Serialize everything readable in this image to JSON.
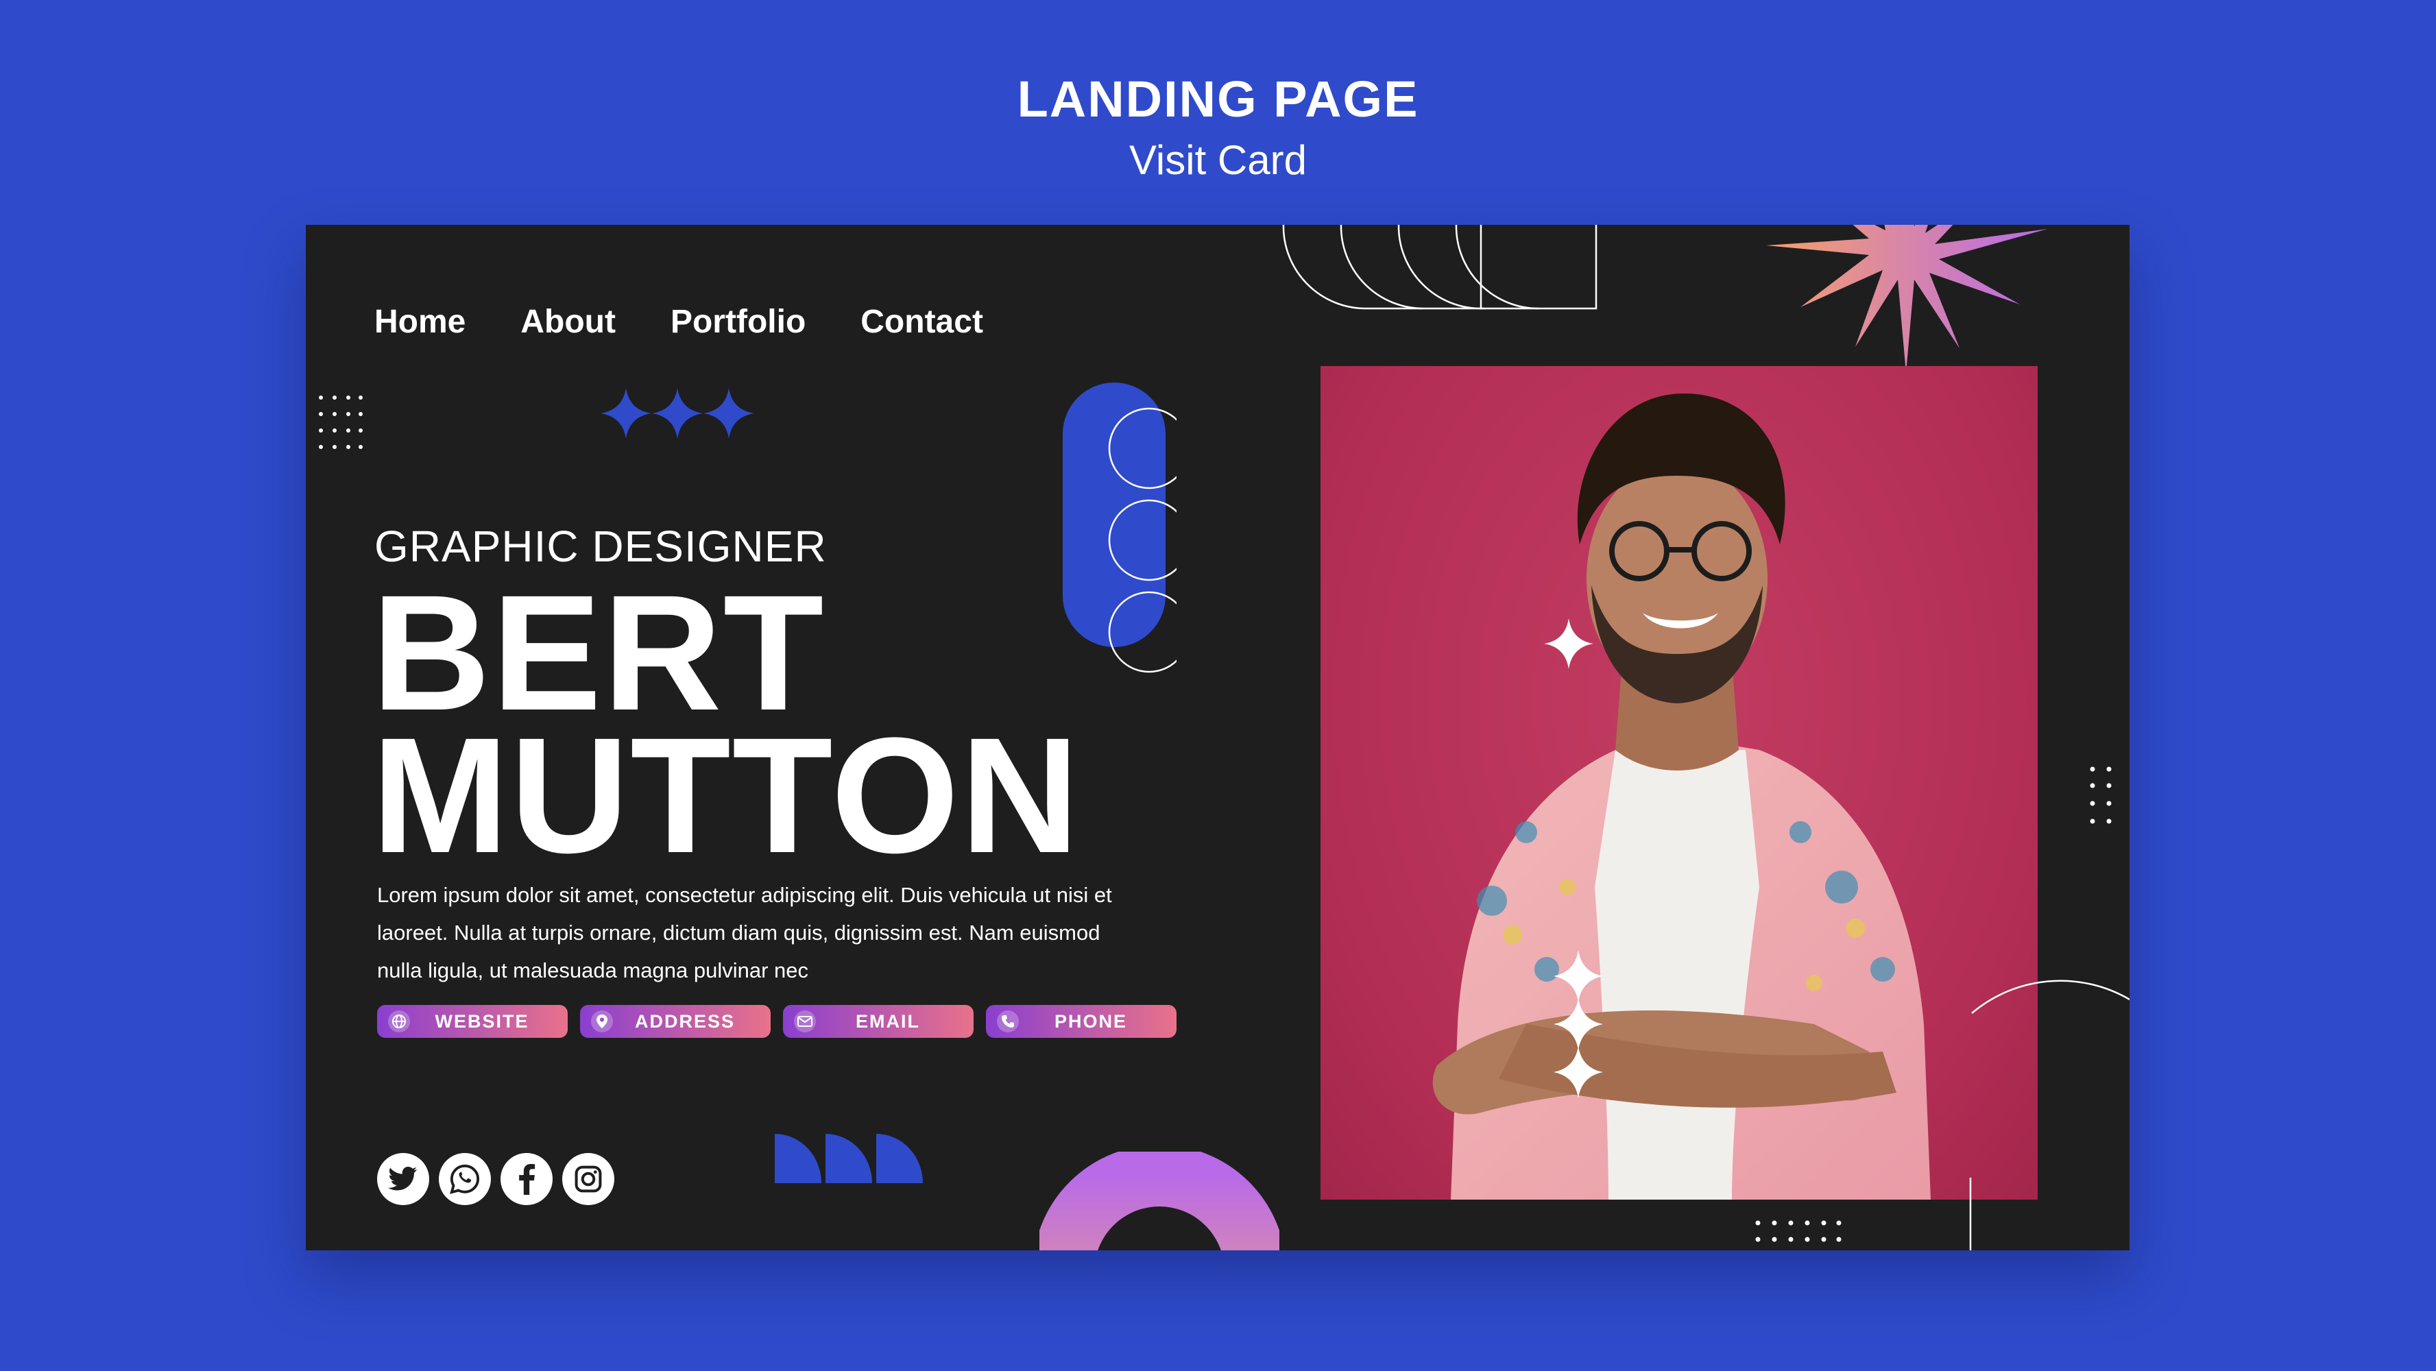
{
  "header": {
    "title": "LANDING PAGE",
    "subtitle": "Visit Card"
  },
  "nav": {
    "items": [
      "Home",
      "About",
      "Portfolio",
      "Contact"
    ]
  },
  "hero": {
    "role": "GRAPHIC DESIGNER",
    "name_line1": "BERT",
    "name_line2": "MUTTON",
    "bio_line1": "Lorem ipsum dolor sit amet, consectetur adipiscing elit. Duis vehicula ut nisi et",
    "bio_line2": "laoreet. Nulla at turpis ornare, dictum diam quis, dignissim est. Nam euismod",
    "bio_line3": "nulla ligula, ut malesuada magna pulvinar nec"
  },
  "contacts": [
    {
      "label": "WEBSITE",
      "icon": "globe-icon"
    },
    {
      "label": "ADDRESS",
      "icon": "location-pin-icon"
    },
    {
      "label": "EMAIL",
      "icon": "mail-icon"
    },
    {
      "label": "PHONE",
      "icon": "phone-icon"
    }
  ],
  "socials": [
    {
      "icon": "twitter-icon"
    },
    {
      "icon": "whatsapp-icon"
    },
    {
      "icon": "facebook-icon"
    },
    {
      "icon": "instagram-icon"
    }
  ],
  "colors": {
    "page_bg": "#2f4bcb",
    "card_bg": "#1e1e1f",
    "accent_blue": "#2f4bcb",
    "photo_bg": "#b32e55",
    "gradient_start": "#8a3fcf",
    "gradient_end": "#e9728a"
  }
}
